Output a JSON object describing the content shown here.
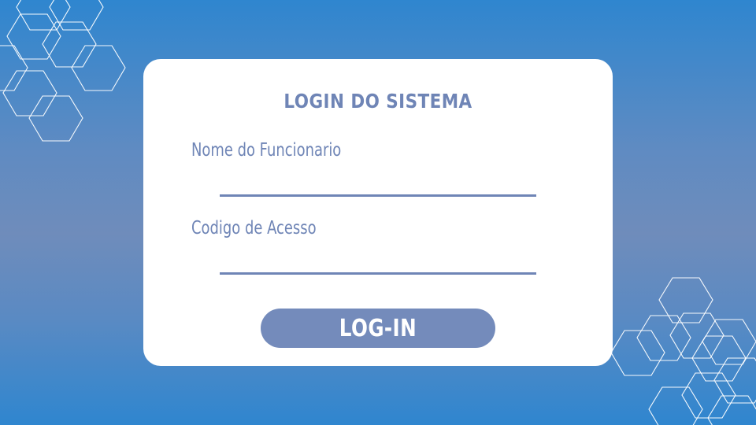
{
  "login": {
    "title": "LOGIN DO SISTEMA",
    "username_label": "Nome do Funcionario",
    "username_value": "",
    "access_code_label": "Codigo de Acesso",
    "access_code_value": "",
    "submit_label": "LOG-IN"
  },
  "colors": {
    "accent": "#748bbb",
    "text": "#6f85b6",
    "background_top": "#2f86cf",
    "background_mid": "#6f8cbb",
    "card": "#ffffff"
  },
  "decorations": {
    "pattern": "hexagon-outline"
  }
}
